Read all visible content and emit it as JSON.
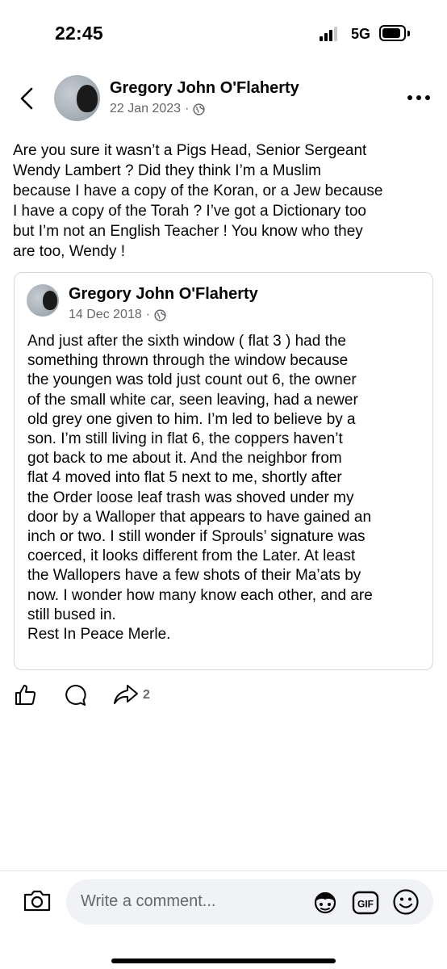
{
  "status_bar": {
    "time": "22:45",
    "network": "5G",
    "signal_bars_active": 3,
    "signal_bars_total": 4
  },
  "header": {
    "author": "Gregory John O'Flaherty",
    "date": "22 Jan 2023",
    "separator": "·",
    "privacy_icon": "globe-icon",
    "back_icon": "chevron-left-icon",
    "more_icon": "more-horizontal-icon"
  },
  "post": {
    "text": "Are you sure it wasn’t a Pigs Head, Senior Sergeant\nWendy Lambert ? Did they think I’m a Muslim\nbecause I have a copy of the Koran, or a Jew because\nI have a copy of the Torah ? I’ve got a Dictionary too\nbut I’m not an English Teacher ! You know who they\nare too, Wendy !"
  },
  "shared": {
    "author": "Gregory John O'Flaherty",
    "date": "14 Dec 2018",
    "separator": "·",
    "privacy_icon": "globe-icon",
    "text": "And just after the sixth window ( flat 3 ) had the\nsomething thrown through the window because\nthe youngen was told just count out 6, the owner\nof the small white car, seen leaving, had a newer\nold grey one given to him. I’m led to believe by a\nson. I’m still living in flat 6, the coppers haven’t\ngot back to me about it. And the neighbor from\nflat 4 moved into flat 5 next to me, shortly after\nthe Order loose leaf trash was shoved under my\ndoor by a Walloper that appears to have gained an\ninch or two. I still wonder if Sprouls’ signature was\ncoerced, it looks different from the Later. At least\nthe Wallopers have a few shots of their Ma’ats by\nnow. I wonder how many know each other, and are\nstill bused in.\n    Rest In Peace Merle."
  },
  "actions": {
    "like_icon": "thumbs-up-icon",
    "comment_icon": "comment-icon",
    "share_icon": "share-icon",
    "share_count": "2"
  },
  "comment_bar": {
    "placeholder": "Write a comment...",
    "camera_icon": "camera-icon",
    "avatar_sticker_icon": "avatar-sticker-icon",
    "gif_label": "GIF",
    "emoji_icon": "emoji-icon"
  },
  "colors": {
    "text_primary": "#050505",
    "text_secondary": "#65676b",
    "input_background": "#f0f2f5",
    "border": "#d6d8db"
  }
}
